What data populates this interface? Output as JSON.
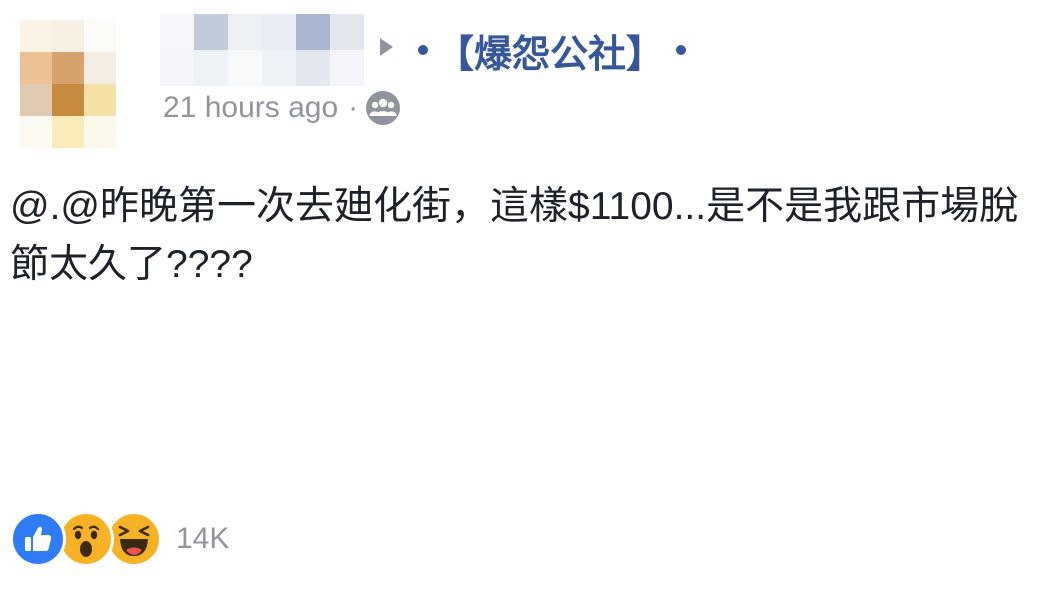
{
  "header": {
    "group_name": "【爆怨公社】",
    "timestamp": "21 hours ago",
    "separator": "·",
    "audience_icon": "group-icon"
  },
  "post": {
    "text": "@.@昨晚第一次去廸化街，這樣$1100...是不是我跟市場脫節太久了????"
  },
  "reactions": {
    "icons": [
      "like-icon",
      "wow-icon",
      "haha-icon"
    ],
    "count": "14K"
  },
  "colors": {
    "link": "#365899",
    "meta": "#90949c",
    "text": "#1d2129",
    "like": "#2e7cf6",
    "emoji": "#f7b125"
  }
}
